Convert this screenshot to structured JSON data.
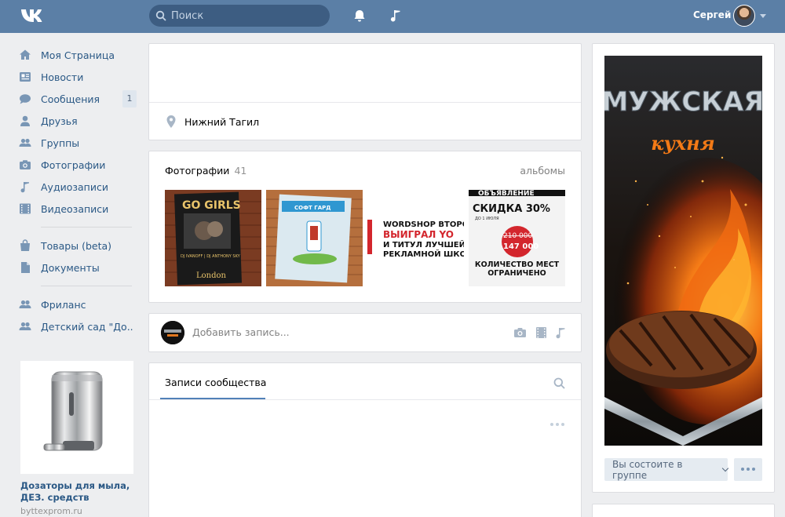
{
  "header": {
    "search_placeholder": "Поиск",
    "user_name": "Сергей"
  },
  "nav": {
    "items": [
      {
        "label": "Моя Страница"
      },
      {
        "label": "Новости"
      },
      {
        "label": "Сообщения",
        "badge": "1"
      },
      {
        "label": "Друзья"
      },
      {
        "label": "Группы"
      },
      {
        "label": "Фотографии"
      },
      {
        "label": "Аудиозаписи"
      },
      {
        "label": "Видеозаписи"
      }
    ],
    "items2": [
      {
        "label": "Товары (beta)"
      },
      {
        "label": "Документы"
      }
    ],
    "items3": [
      {
        "label": "Фриланс"
      },
      {
        "label": "Детский сад \"До.."
      }
    ]
  },
  "ad": {
    "title": "Дозаторы для мыла, ДЕЗ. средств",
    "url": "byttexprom.ru"
  },
  "info": {
    "city": "Нижний Тагил"
  },
  "photos": {
    "title": "Фотографии",
    "count": "41",
    "albums_link": "альбомы",
    "items": [
      {
        "text1": "GO GIRLS",
        "text2": "DJ IVANOFF | DJ ANTHONY SKY",
        "text3": "London"
      },
      {
        "text1": "СОФТ ГАРД"
      },
      {
        "text1": "WORDSHOP ВТОРО",
        "text2": "ВЫИГРАЛ YO",
        "text3": "И ТИТУЛ ЛУЧШЕЙ",
        "text4": "РЕКЛАМНОЙ ШКО"
      },
      {
        "text1": "ОБЪЯВЛЕНИЕ",
        "text2": "СКИДКА 30%",
        "text3": "ДО 1 ИЮЛЯ",
        "text4": "210 000",
        "text5": "147 000",
        "text6": "КОЛИЧЕСТВО МЕСТ ОГРАНИЧЕНО"
      }
    ]
  },
  "composer": {
    "placeholder": "Добавить запись..."
  },
  "wall": {
    "tab_label": "Записи сообщества"
  },
  "cover": {
    "line1": "МУЖСКАЯ",
    "line2": "кухня"
  },
  "group": {
    "member_label": "Вы состоите в группе"
  }
}
